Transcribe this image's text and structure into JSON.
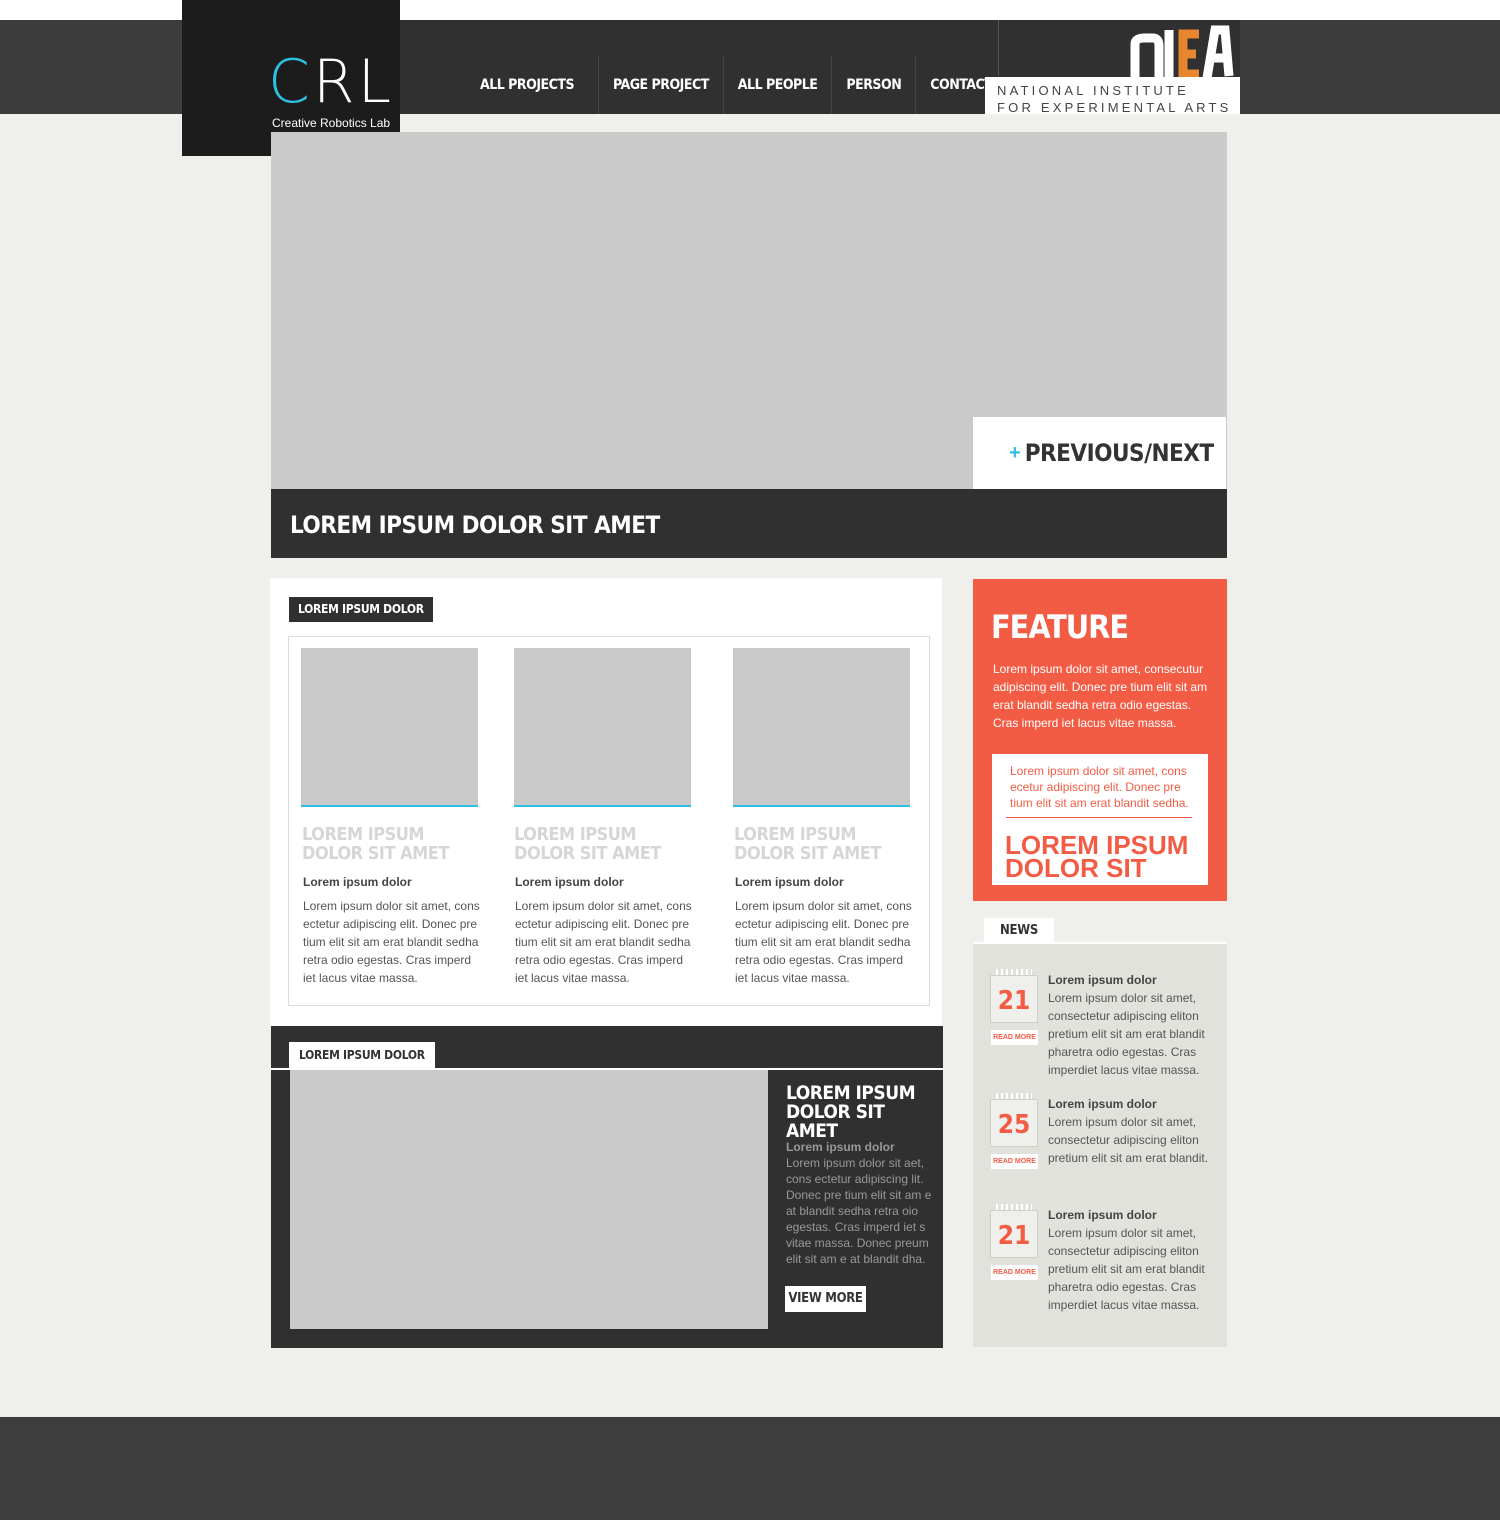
{
  "brand": {
    "logo_c": "C",
    "logo_rest": "RL",
    "subtitle": "Creative Robotics Lab",
    "accent_color": "#2fbfe2"
  },
  "nav": [
    "ALL PROJECTS",
    "PAGE PROJECT",
    "ALL PEOPLE",
    "PERSON",
    "CONTACT"
  ],
  "partner": {
    "mark": "NIEA",
    "line1": "NATIONAL INSTITUTE",
    "line2": "FOR EXPERIMENTAL ARTS"
  },
  "hero": {
    "nav_label": "PREVIOUS/NEXT",
    "caption": "LOREM IPSUM DOLOR SIT AMET"
  },
  "section1": {
    "tag": "LOREM IPSUM DOLOR",
    "cards": [
      {
        "title1": "LOREM IPSUM",
        "title2": "DOLOR SIT AMET",
        "sub": "Lorem ipsum dolor",
        "body": "Lorem ipsum dolor sit amet, cons ectetur adipiscing elit. Donec pre tium elit sit am erat blandit sedha retra odio egestas. Cras imperd iet lacus vitae massa."
      },
      {
        "title1": "LOREM IPSUM",
        "title2": "DOLOR SIT AMET",
        "sub": "Lorem ipsum dolor",
        "body": "Lorem ipsum dolor sit amet, cons ectetur adipiscing elit. Donec pre tium elit sit am erat blandit sedha retra odio egestas. Cras imperd iet lacus vitae massa."
      },
      {
        "title1": "LOREM IPSUM",
        "title2": "DOLOR SIT AMET",
        "sub": "Lorem ipsum dolor",
        "body": "Lorem ipsum dolor sit amet, cons ectetur adipiscing elit. Donec pre tium elit sit am erat blandit sedha retra odio egestas. Cras imperd iet lacus vitae massa."
      }
    ]
  },
  "section2": {
    "tag": "LOREM IPSUM DOLOR",
    "title1": "LOREM IPSUM",
    "title2": "DOLOR SIT AMET",
    "sub": "Lorem ipsum dolor",
    "body": "Lorem ipsum dolor sit aet, cons ectetur adipiscing lit. Donec pre tium elit sit am e at blandit sedha retra oio egestas. Cras imperd iet s vitae massa. Donec preum elit sit am e at blandit dha.",
    "button": "VIEW MORE"
  },
  "feature": {
    "title": "FEATURE",
    "body": "Lorem ipsum dolor sit amet, consecutur adipiscing elit. Donec pre tium elit sit am erat blandit sedha retra odio egestas. Cras imperd iet lacus vitae massa.",
    "card_text": "Lorem ipsum dolor sit amet, cons ecetur adipiscing elit. Donec pre tium elit sit am erat blandit sedha.",
    "card_big1": "LOREM IPSUM",
    "card_big2": "DOLOR SIT",
    "color": "#f25c45"
  },
  "news": {
    "tab": "NEWS",
    "items": [
      {
        "day": "21",
        "readmore": "READ MORE",
        "head": "Lorem ipsum dolor",
        "body": "Lorem ipsum dolor sit amet, consectetur adipiscing eliton pretium elit sit am erat blandit pharetra odio egestas. Cras imperdiet lacus vitae massa."
      },
      {
        "day": "25",
        "readmore": "READ MORE",
        "head": "Lorem ipsum dolor",
        "body": "Lorem ipsum dolor sit amet, consectetur adipiscing eliton pretium elit sit am erat blandit."
      },
      {
        "day": "21",
        "readmore": "READ MORE",
        "head": "Lorem ipsum dolor",
        "body": "Lorem ipsum dolor sit amet, consectetur adipiscing eliton pretium elit sit am erat blandit pharetra odio egestas. Cras imperdiet lacus vitae massa."
      }
    ]
  }
}
